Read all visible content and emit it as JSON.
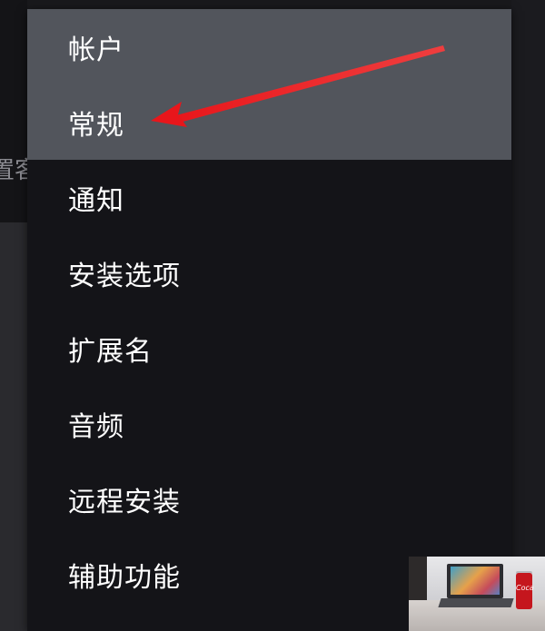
{
  "background": {
    "left_partial_text": "置客"
  },
  "menu": {
    "items": [
      {
        "label": "帐户"
      },
      {
        "label": "常规"
      },
      {
        "label": "通知"
      },
      {
        "label": "安装选项"
      },
      {
        "label": "扩展名"
      },
      {
        "label": "音频"
      },
      {
        "label": "远程安装"
      },
      {
        "label": "辅助功能"
      }
    ],
    "highlighted_items": [
      "帐户",
      "常规"
    ]
  },
  "annotation": {
    "arrow_color": "#e8161b",
    "points_to": "常规"
  },
  "thumbnail": {
    "can_text": "Coca"
  },
  "colors": {
    "menu_bg": "#141418",
    "highlight_bg": "#52555c",
    "text": "#ffffff"
  }
}
